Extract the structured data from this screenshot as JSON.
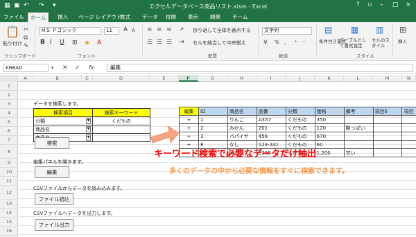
{
  "titlebar": {
    "title": "エクセルデータベース商品リスト.xlsm - Excel",
    "qat_icons": [
      "save-icon",
      "undo-icon",
      "redo-icon",
      "customize-icon"
    ],
    "controls": [
      "?",
      "▫",
      "–",
      "□",
      "×"
    ]
  },
  "tabs": [
    "ファイル",
    "ホーム",
    "挿入",
    "ページ レイアウト",
    "数式",
    "データ",
    "校閲",
    "表示",
    "開発",
    "チーム"
  ],
  "ribbon": {
    "clipboard": {
      "paste": "貼り付け",
      "group": "クリップボード"
    },
    "font": {
      "name": "ＭＳ Ｐゴシック",
      "size": "11",
      "grow": "A",
      "shrink": "A",
      "bold": "B",
      "italic": "I",
      "underline": "U",
      "group": "フォント"
    },
    "align": {
      "wrap": "折り返して全体を表示する",
      "merge": "セルを結合して中央揃え",
      "group": "配置"
    },
    "number": {
      "format": "文字列",
      "pct": "%",
      "comma": ",",
      "group": "数値"
    },
    "styles": {
      "conditional": "条件付き書式",
      "table": "テーブルとして書式設定",
      "cellstyle": "セルのスタイル",
      "group": "スタイル"
    },
    "cells": {
      "insert": "挿入",
      "group": "セル"
    }
  },
  "formulabar": {
    "namebox": "KHEAD",
    "fx": "fx",
    "value": "編集"
  },
  "columns": [
    "A",
    "B",
    "C",
    "D",
    "E",
    "F",
    "G",
    "H",
    "I",
    "J",
    "K",
    "L",
    "M",
    "N"
  ],
  "rows": [
    "1",
    "2",
    "3",
    "4",
    "5",
    "6",
    "7",
    "8",
    "9",
    "10",
    "11",
    "12",
    "13",
    "14",
    "15",
    "16",
    "17"
  ],
  "sheet": {
    "search_intro": "データを検索します。",
    "search_header_item": "検索項目",
    "search_header_keyword": "検索キーワード",
    "criteria": [
      {
        "item": "分類",
        "keyword": "くだもの"
      },
      {
        "item": "商品名",
        "keyword": ""
      },
      {
        "item": "商品名",
        "keyword": ""
      }
    ],
    "search_btn": "検索",
    "edit_intro": "編集パネルを開きます。",
    "edit_btn": "編集",
    "csv_in_intro": "CSVファイルからデータを読み込みます。",
    "csv_in_btn": "ファイル読込",
    "csv_out_intro": "CSVファイルへデータを出力します。",
    "csv_out_btn": "ファイル出力"
  },
  "table": {
    "headers": [
      "編集",
      "ID",
      "商品名",
      "品番",
      "分類",
      "価格",
      "備考",
      "項目6",
      "項目"
    ],
    "rows": [
      [
        "+",
        "1",
        "りんご",
        "A357",
        "くだもの",
        "350",
        "",
        ""
      ],
      [
        "+",
        "2",
        "みかん",
        "201",
        "くだもの",
        "120",
        "酸っぱい",
        ""
      ],
      [
        "+",
        "3",
        "バパイヤ",
        "456",
        "くだもの",
        "670",
        "",
        ""
      ],
      [
        "+",
        "8",
        "なし",
        "123-241",
        "くだもの",
        "60",
        "",
        ""
      ],
      [
        "+",
        "9",
        "メロン",
        "E300",
        "くだもの",
        "1,200",
        "甘い",
        ""
      ]
    ]
  },
  "overlay": {
    "headline": "キーワード検索で必要なデータだけ抽出",
    "subline": "多くのデータの中から必要な情報をすぐに検索できます。"
  },
  "colors": {
    "excel_green": "#217346",
    "header_yellow": "#ffff00",
    "table_header_blue": "#bdd7ee",
    "headline_red": "#ff0000",
    "subline_orange": "#f79646",
    "arrow_salmon": "#f4a582"
  }
}
